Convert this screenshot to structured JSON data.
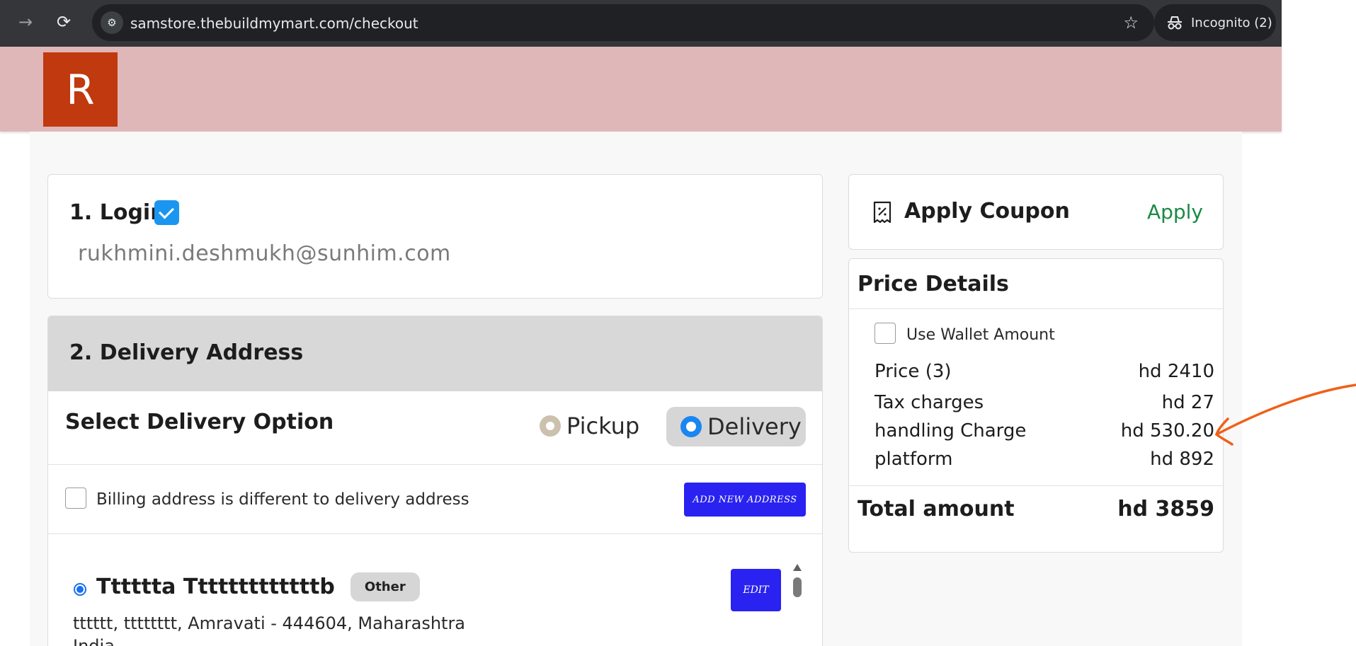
{
  "browser": {
    "url": "samstore.thebuildmymart.com/checkout",
    "incognito_label": "Incognito (2)",
    "forward_icon": "→",
    "reload_icon": "⟳",
    "site_info_icon": "⚙",
    "star_icon": "☆"
  },
  "header": {
    "logo_letter": "R",
    "logo_color": "#c0390f",
    "background_color": "#e0b7b8"
  },
  "login": {
    "title": "1. Login",
    "checked": true,
    "email": "rukhmini.deshmukh@sunhim.com"
  },
  "delivery": {
    "title": "2. Delivery Address",
    "option_label": "Select Delivery Option",
    "options": [
      {
        "label": "Pickup",
        "selected": false
      },
      {
        "label": "Delivery",
        "selected": true
      }
    ],
    "billing_different_label": "Billing address is different to delivery address",
    "billing_different_checked": false,
    "add_new_address_label": "ADD NEW ADDRESS",
    "address": {
      "name": "Tttttta Tttttttttttttb",
      "tag": "Other",
      "line": "tttttt, tttttttt, Amravati - 444604, Maharashtra",
      "country": "India",
      "selected": true,
      "edit_label": "EDIT"
    }
  },
  "coupon": {
    "title": "Apply Coupon",
    "apply_label": "Apply",
    "apply_color": "#1a8a45"
  },
  "price_details": {
    "title": "Price Details",
    "wallet_label": "Use Wallet Amount",
    "wallet_checked": false,
    "rows": [
      {
        "label": "Price (3)",
        "value": "hd 2410"
      },
      {
        "label": "Tax charges",
        "value": "hd 27"
      },
      {
        "label": "handling Charge",
        "value": "hd 530.20"
      },
      {
        "label": "platform",
        "value": "hd 892"
      }
    ],
    "total_label": "Total amount",
    "total_value": "hd 3859"
  },
  "annotation": {
    "color": "#f06018",
    "points_to": "handling Charge"
  }
}
